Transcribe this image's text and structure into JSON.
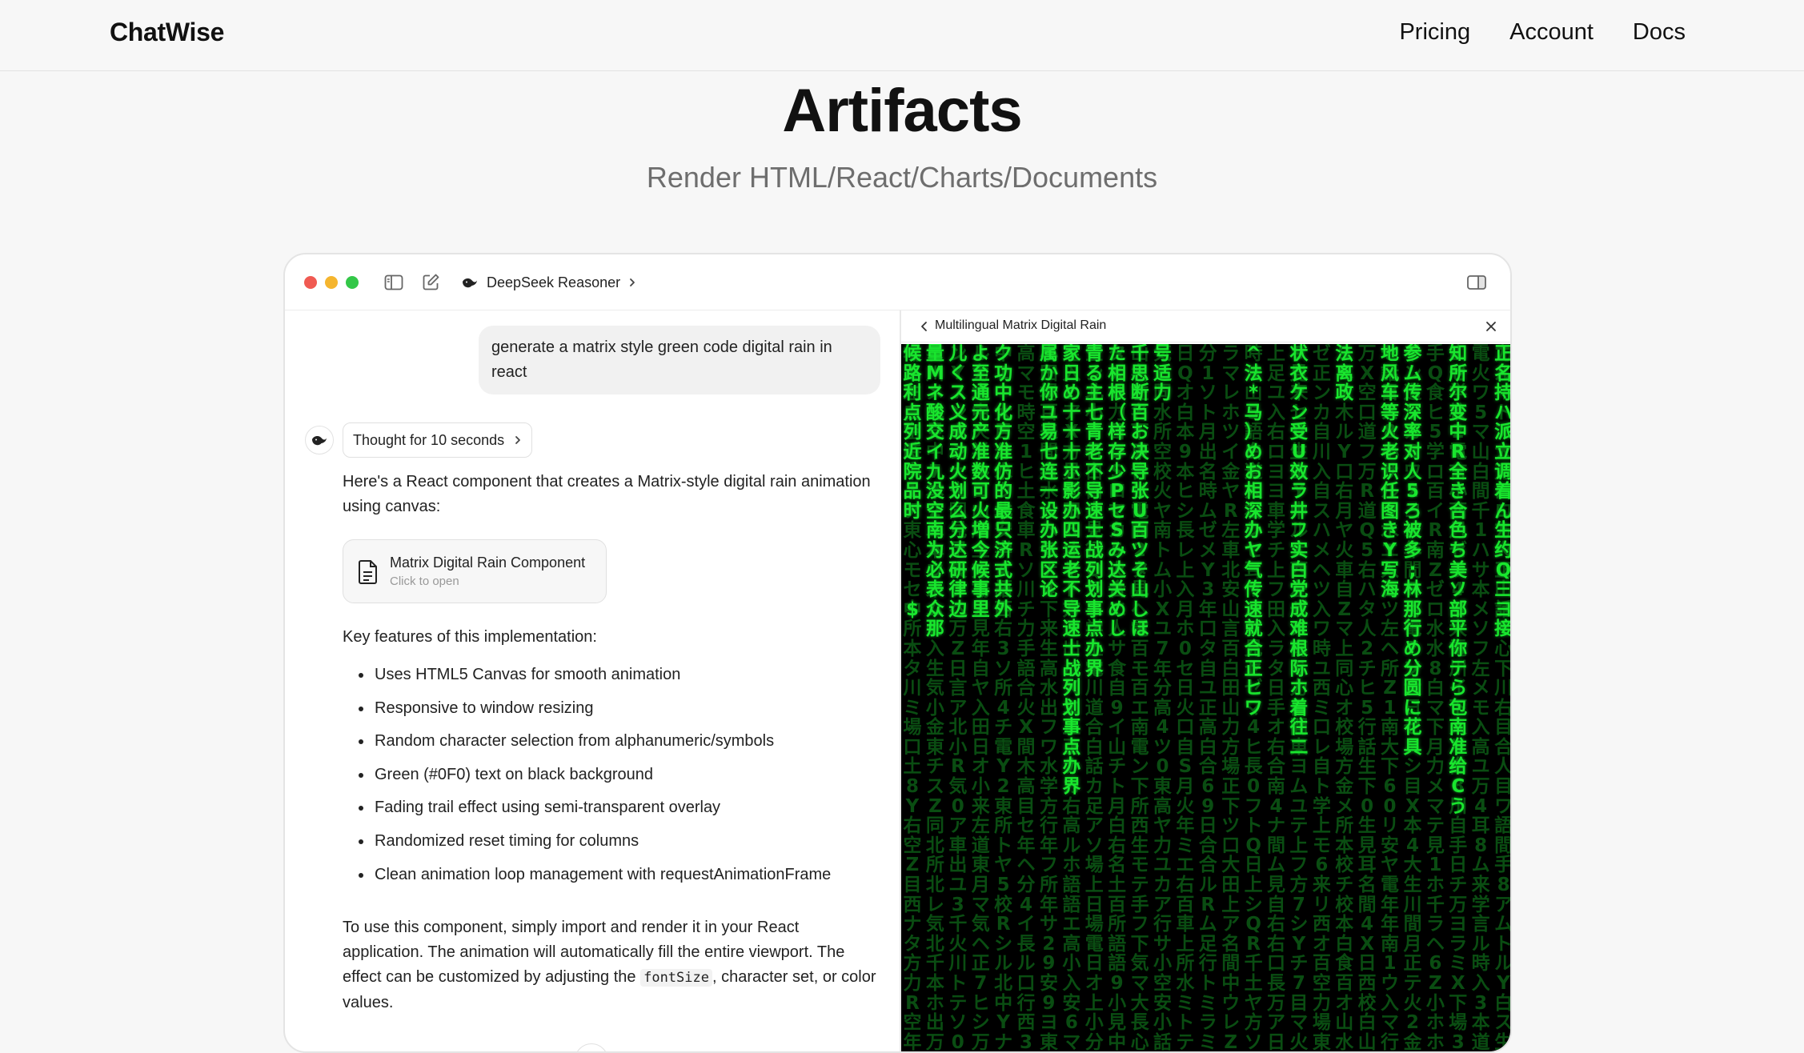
{
  "site": {
    "brand": "ChatWise",
    "nav": [
      "Pricing",
      "Account",
      "Docs"
    ]
  },
  "hero": {
    "title": "Artifacts",
    "subtitle": "Render HTML/React/Charts/Documents"
  },
  "window": {
    "model_name": "DeepSeek Reasoner"
  },
  "chat": {
    "user_message": "generate a matrix style green code digital rain in react",
    "thought_label": "Thought for 10 seconds",
    "intro": "Here's a React component that creates a Matrix-style digital rain animation using canvas:",
    "artifact_card": {
      "title": "Matrix Digital Rain Component",
      "hint": "Click to open"
    },
    "features_heading": "Key features of this implementation:",
    "features": [
      "Uses HTML5 Canvas for smooth animation",
      "Responsive to window resizing",
      "Random character selection from alphanumeric/symbols",
      "Green (#0F0) text on black background",
      "Fading trail effect using semi-transparent overlay",
      "Randomized reset timing for columns",
      "Clean animation loop management with requestAnimationFrame"
    ],
    "outro_before_code": "To use this component, simply import and render it in your React application. The animation will automatically fill the entire viewport. The effect can be customized by adjusting the ",
    "outro_code": "fontSize",
    "outro_after_code": ", character set, or color values."
  },
  "artifact_panel": {
    "title": "Multilingual Matrix Digital Rain",
    "matrix_columns": [
      "候路利点列近院品时\n\n\n$",
      "量Mネ酸交イ九没空南为必表众那",
      "儿くス义成动火划么分达研律边",
      "よ至通元产准数可火増今候事里",
      "ク功中化方准仿的最只济式共外",
      "",
      "属か你ユ易七连一设办张区论",
      "家日め十十十ホ影办四运老不导速士战列划事点办界",
      "青る主七青老不导速士战列划事点办界",
      "た相根（样存少PセSみ达关めし",
      "千思断百お决导张U百ツそ山しほ",
      "号适力",
      "",
      "",
      "",
      "^法*马）めお相深办ヤ气传速就合正ヒワ",
      "",
      "状衣ケン受U效ラ井フ实白党成难根际ホ着往二",
      "",
      "法离政",
      "",
      "地风车等火老识任图きY写海",
      "参ム传深率对人5ろ被多;林那行め分圆に花具",
      "",
      "知所尔变中R全き合色ち美ソ部平你テら包南准给Cう",
      "",
      "正名持ハ派立调着ん生约Q三ヨ接"
    ],
    "colors": {
      "bright": "#19e62e",
      "mid": "#0d9a1e",
      "dim": "#0a4d12",
      "background": "#000000"
    }
  }
}
